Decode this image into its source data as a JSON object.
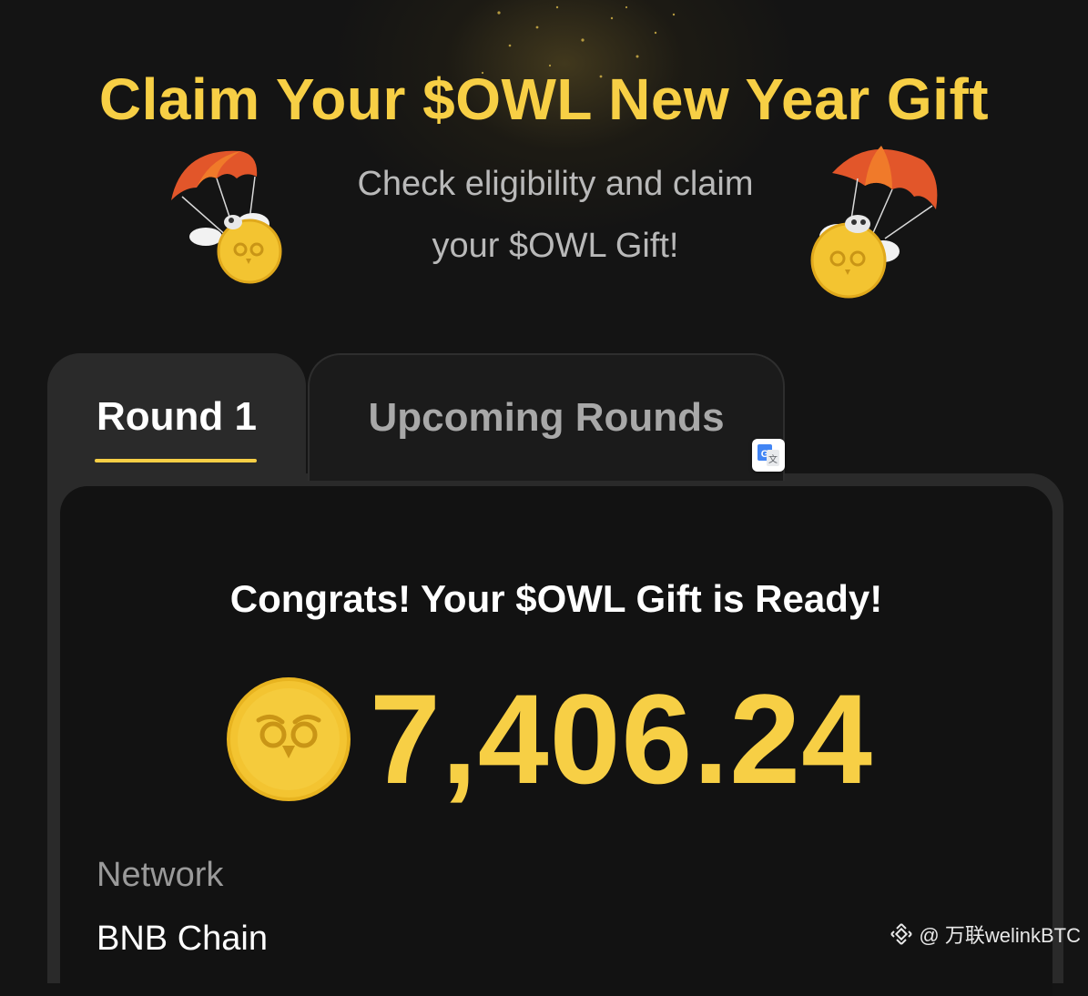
{
  "hero": {
    "title": "Claim Your $OWL New Year Gift",
    "subtitle_line1": "Check eligibility and claim",
    "subtitle_line2": "your $OWL Gift!"
  },
  "tabs": [
    {
      "label": "Round 1",
      "active": true
    },
    {
      "label": "Upcoming Rounds",
      "active": false
    }
  ],
  "card": {
    "congrats": "Congrats! Your $OWL Gift is Ready!",
    "amount": "7,406.24",
    "network_label": "Network",
    "network_value": "BNB Chain"
  },
  "watermark": {
    "text": "@ 万联welinkBTC"
  },
  "icons": {
    "coin": "owl-coin-icon",
    "translate": "google-translate-icon",
    "mascot": "parachute-owl-mascot",
    "binance": "binance-logo-icon"
  },
  "colors": {
    "accent": "#f7cf45",
    "background": "#141414",
    "tab_active_bg": "#2a2a2a",
    "card_bg": "#121212",
    "muted_text": "#9a9a9a"
  }
}
